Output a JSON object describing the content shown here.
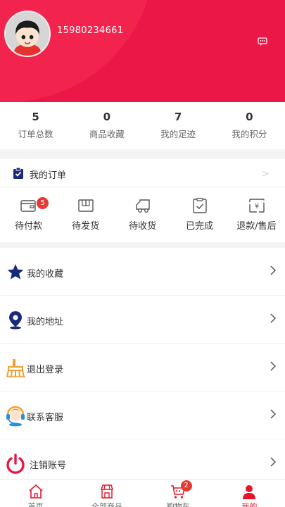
{
  "profile": {
    "phone": "15980234661",
    "avatar_icon": "avatar-cartoon-boy",
    "message_icon": "message-icon"
  },
  "stats": [
    {
      "value": "5",
      "label": "订单总数"
    },
    {
      "value": "0",
      "label": "商品收藏"
    },
    {
      "value": "7",
      "label": "我的足迹"
    },
    {
      "value": "0",
      "label": "我的积分"
    }
  ],
  "orders": {
    "title": "我的订单",
    "items": [
      {
        "label": "待付款",
        "icon": "wallet-icon",
        "badge": "5"
      },
      {
        "label": "待发货",
        "icon": "package-icon"
      },
      {
        "label": "待收货",
        "icon": "truck-icon"
      },
      {
        "label": "已完成",
        "icon": "clipboard-check-icon"
      },
      {
        "label": "退款/售后",
        "icon": "refund-icon"
      }
    ]
  },
  "menu": [
    {
      "label": "我的收藏",
      "icon": "star-icon"
    },
    {
      "label": "我的地址",
      "icon": "location-icon"
    },
    {
      "label": "退出登录",
      "icon": "broom-icon"
    },
    {
      "label": "联系客服",
      "icon": "customer-service-icon"
    },
    {
      "label": "注销账号",
      "icon": "power-icon"
    }
  ],
  "tabbar": [
    {
      "label": "首页",
      "icon": "home-icon"
    },
    {
      "label": "全部商品",
      "icon": "store-icon"
    },
    {
      "label": "购物车",
      "icon": "cart-icon",
      "badge": "2"
    },
    {
      "label": "我的",
      "icon": "user-icon",
      "active": true
    }
  ],
  "colors": {
    "brand_red": "#eb1746",
    "badge_red": "#e53935",
    "navy": "#1a2a7a",
    "orange": "#f0a030"
  }
}
